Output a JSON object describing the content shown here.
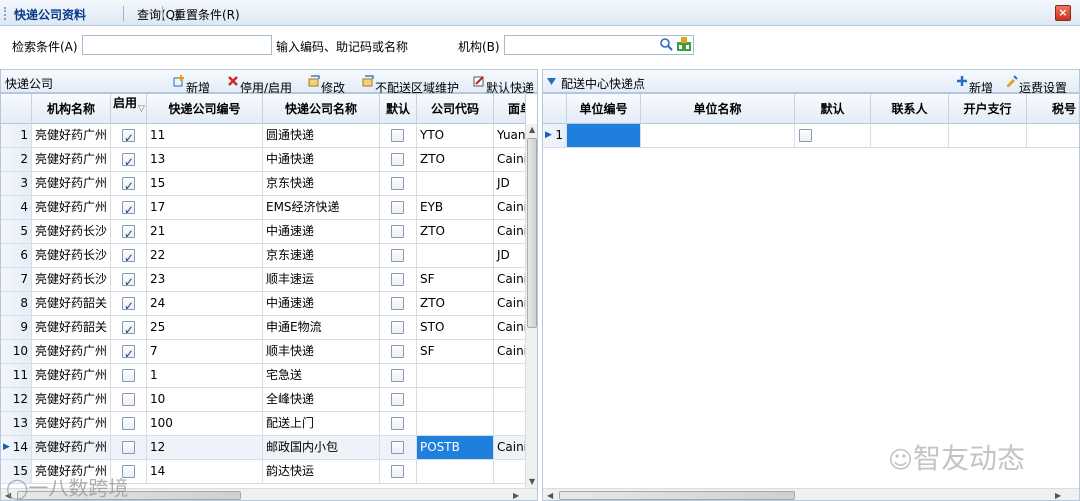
{
  "menu": {
    "title": "快递公司资料",
    "query": "查询(Q)",
    "reset": "重置条件(R)",
    "close": "×"
  },
  "search": {
    "cond_label": "检索条件(A)",
    "cond_value": "",
    "hint": "输入编码、助记码或名称",
    "org_label": "机构(B)",
    "org_value": ""
  },
  "left_panel": {
    "title": "快递公司",
    "toolbar": [
      "新增",
      "停用/启用",
      "修改",
      "不配送区域维护",
      "默认快递"
    ],
    "columns": [
      "机构名称",
      "启用",
      "快递公司编号",
      "快递公司名称",
      "默认",
      "公司代码",
      "面单"
    ],
    "rows": [
      {
        "n": "1",
        "org": "亮健好药广州",
        "enabled": true,
        "code": "11",
        "name": "圆通快递",
        "def": false,
        "ccode": "YTO",
        "face": "Yuan"
      },
      {
        "n": "2",
        "org": "亮健好药广州",
        "enabled": true,
        "code": "13",
        "name": "中通快递",
        "def": false,
        "ccode": "ZTO",
        "face": "Caini"
      },
      {
        "n": "3",
        "org": "亮健好药广州",
        "enabled": true,
        "code": "15",
        "name": "京东快递",
        "def": false,
        "ccode": "",
        "face": "JD"
      },
      {
        "n": "4",
        "org": "亮健好药广州",
        "enabled": true,
        "code": "17",
        "name": "EMS经济快递",
        "def": false,
        "ccode": "EYB",
        "face": "Caini"
      },
      {
        "n": "5",
        "org": "亮健好药长沙",
        "enabled": true,
        "code": "21",
        "name": "中通速递",
        "def": false,
        "ccode": "ZTO",
        "face": "Caini"
      },
      {
        "n": "6",
        "org": "亮健好药长沙",
        "enabled": true,
        "code": "22",
        "name": "京东速递",
        "def": false,
        "ccode": "",
        "face": "JD"
      },
      {
        "n": "7",
        "org": "亮健好药长沙",
        "enabled": true,
        "code": "23",
        "name": "顺丰速运",
        "def": false,
        "ccode": "SF",
        "face": "Caini"
      },
      {
        "n": "8",
        "org": "亮健好药韶关",
        "enabled": true,
        "code": "24",
        "name": "中通速递",
        "def": false,
        "ccode": "ZTO",
        "face": "Caini"
      },
      {
        "n": "9",
        "org": "亮健好药韶关",
        "enabled": true,
        "code": "25",
        "name": "申通E物流",
        "def": false,
        "ccode": "STO",
        "face": "Caini"
      },
      {
        "n": "10",
        "org": "亮健好药广州",
        "enabled": true,
        "code": "7",
        "name": "顺丰快递",
        "def": false,
        "ccode": "SF",
        "face": "Caini"
      },
      {
        "n": "11",
        "org": "亮健好药广州",
        "enabled": false,
        "code": "1",
        "name": "宅急送",
        "def": false,
        "ccode": "",
        "face": ""
      },
      {
        "n": "12",
        "org": "亮健好药广州",
        "enabled": false,
        "code": "10",
        "name": "全峰快递",
        "def": false,
        "ccode": "",
        "face": ""
      },
      {
        "n": "13",
        "org": "亮健好药广州",
        "enabled": false,
        "code": "100",
        "name": "配送上门",
        "def": false,
        "ccode": "",
        "face": ""
      },
      {
        "n": "14",
        "org": "亮健好药广州",
        "enabled": false,
        "code": "12",
        "name": "邮政国内小包",
        "def": false,
        "ccode": "POSTB",
        "face": "Caini"
      },
      {
        "n": "15",
        "org": "亮健好药广州",
        "enabled": false,
        "code": "14",
        "name": "韵达快运",
        "def": false,
        "ccode": "",
        "face": ""
      }
    ],
    "current_row": "14"
  },
  "right_panel": {
    "title": "配送中心快递点",
    "toolbar": [
      "新增",
      "运费设置"
    ],
    "columns": [
      "单位编号",
      "单位名称",
      "默认",
      "联系人",
      "开户支行",
      "税号"
    ],
    "rows": [
      {
        "n": "1",
        "code": "",
        "name": "",
        "def": false,
        "contact": "",
        "bank": "",
        "tax": ""
      }
    ]
  },
  "watermarks": {
    "right": "智友动态",
    "left": "一八数跨境"
  },
  "colors": {
    "selection": "#1f7fdc",
    "header_bg": "#e4ecf6",
    "accent": "#0a3a8a"
  },
  "icons": [
    "add-icon",
    "disable-icon",
    "edit-icon",
    "area-icon",
    "default-icon",
    "search-icon",
    "org-tree-icon",
    "close-icon"
  ]
}
